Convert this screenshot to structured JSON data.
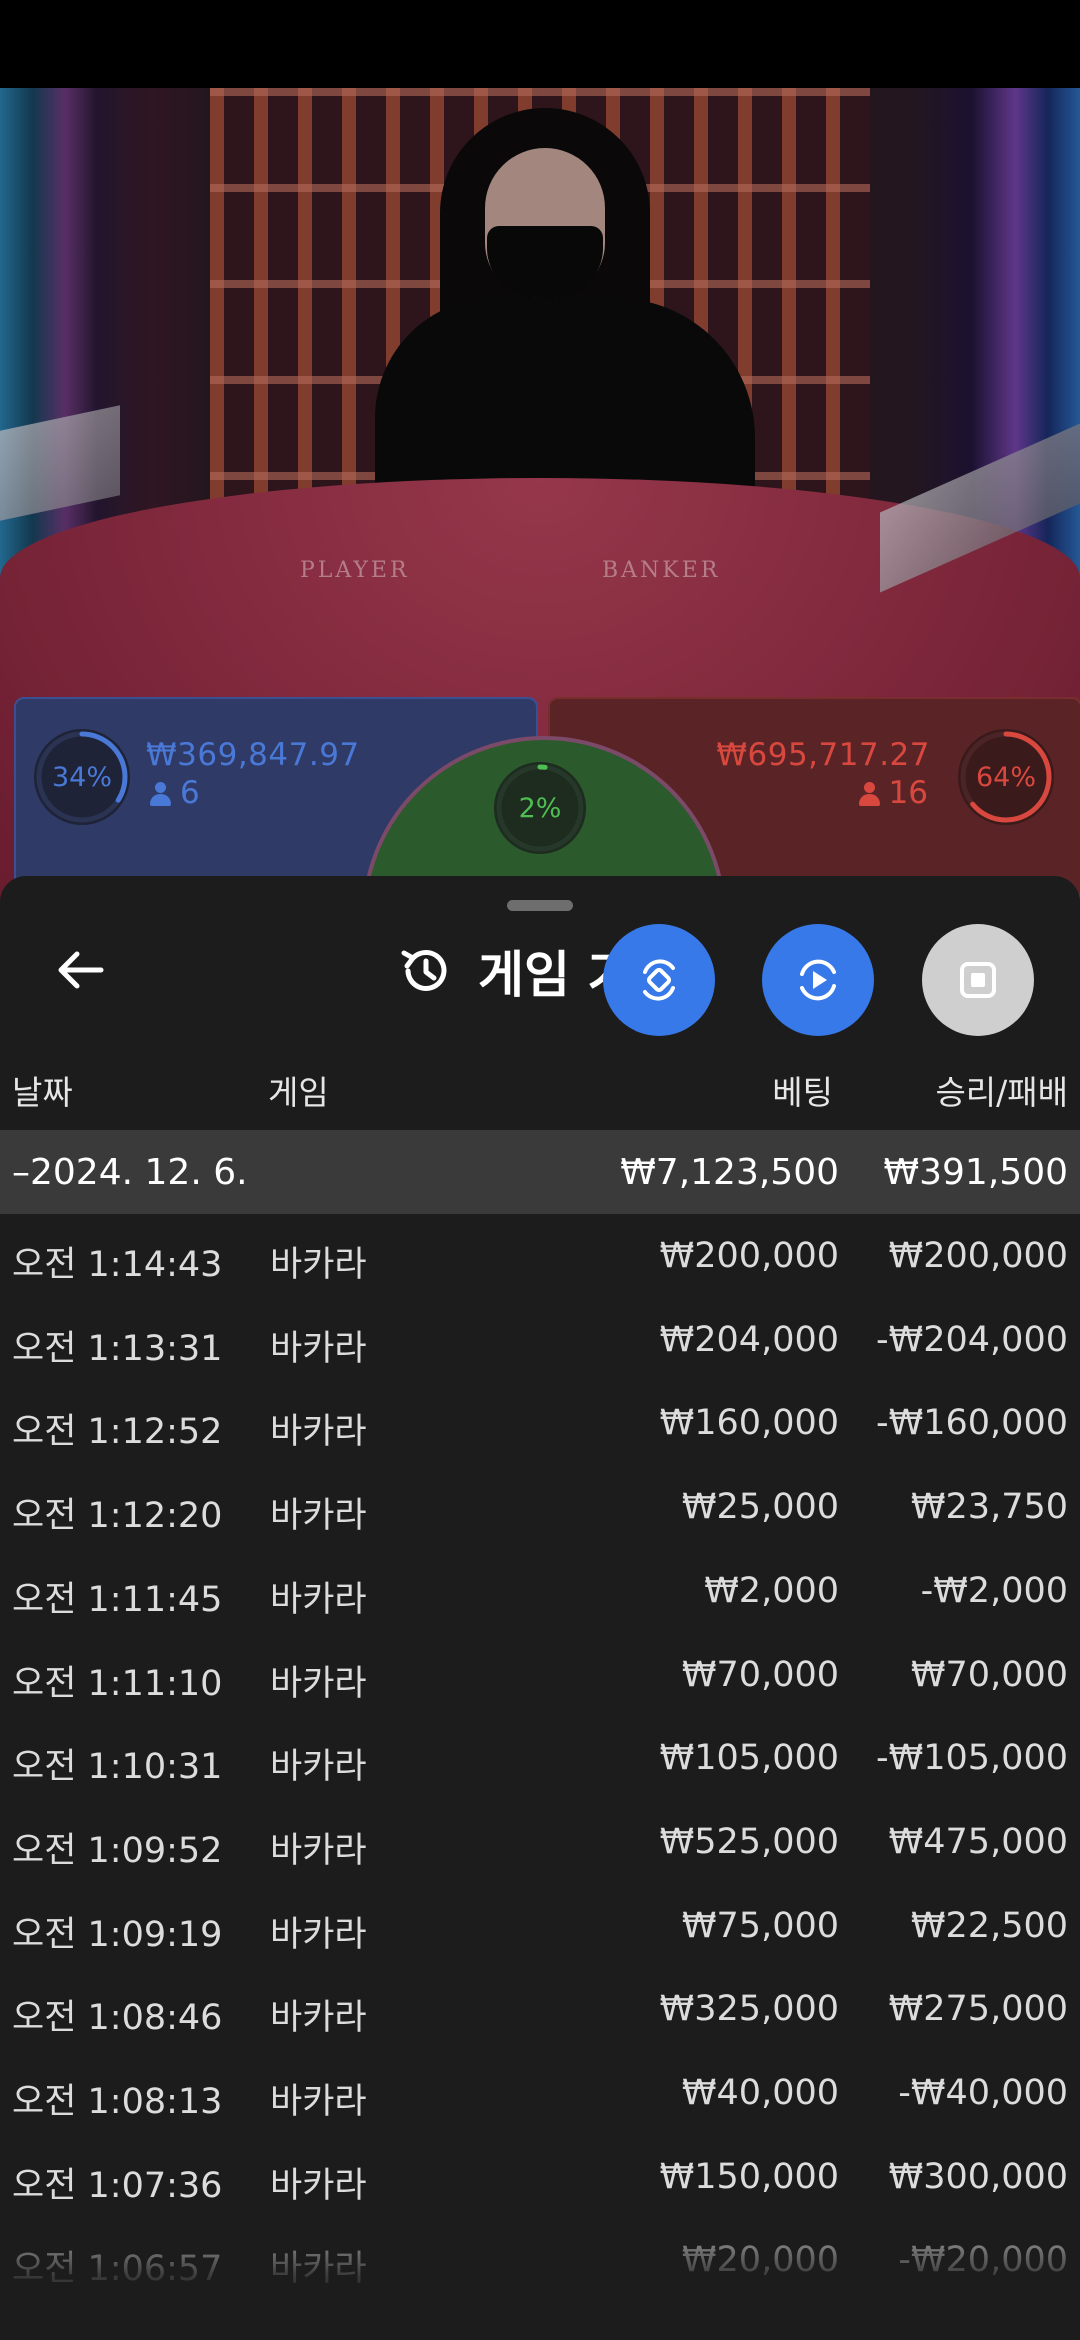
{
  "stream": {
    "table_labels": [
      "PLAYER",
      "BANKER"
    ]
  },
  "bets": {
    "player": {
      "percent_text": "34%",
      "percent": 34,
      "amount": "₩369,847.97",
      "count": "6",
      "color": "#4a78d6"
    },
    "tie": {
      "percent_text": "2%",
      "percent": 2,
      "color": "#4fbe52"
    },
    "banker": {
      "percent_text": "64%",
      "percent": 64,
      "amount": "₩695,717.27",
      "count": "16",
      "color": "#d9483e"
    }
  },
  "sheet": {
    "title": "게임 기록",
    "back_icon": "arrow-left-icon",
    "history_icon": "history-icon",
    "buttons": [
      {
        "name": "sync-icon",
        "color": "#3779e8"
      },
      {
        "name": "replay-icon",
        "color": "#3779e8"
      },
      {
        "name": "stop-icon",
        "color": "#cfcfcf"
      }
    ],
    "columns": {
      "date": "날짜",
      "game": "게임",
      "bet": "베팅",
      "result": "승리/패배"
    },
    "date_group": {
      "label": "–2024. 12. 6.",
      "bet_total": "₩7,123,500",
      "result_total": "₩391,500"
    },
    "rows": [
      {
        "time": "오전 1:14:43",
        "game": "바카라",
        "bet": "₩200,000",
        "result": "₩200,000"
      },
      {
        "time": "오전 1:13:31",
        "game": "바카라",
        "bet": "₩204,000",
        "result": "-₩204,000"
      },
      {
        "time": "오전 1:12:52",
        "game": "바카라",
        "bet": "₩160,000",
        "result": "-₩160,000"
      },
      {
        "time": "오전 1:12:20",
        "game": "바카라",
        "bet": "₩25,000",
        "result": "₩23,750"
      },
      {
        "time": "오전 1:11:45",
        "game": "바카라",
        "bet": "₩2,000",
        "result": "-₩2,000"
      },
      {
        "time": "오전 1:11:10",
        "game": "바카라",
        "bet": "₩70,000",
        "result": "₩70,000"
      },
      {
        "time": "오전 1:10:31",
        "game": "바카라",
        "bet": "₩105,000",
        "result": "-₩105,000"
      },
      {
        "time": "오전 1:09:52",
        "game": "바카라",
        "bet": "₩525,000",
        "result": "₩475,000"
      },
      {
        "time": "오전 1:09:19",
        "game": "바카라",
        "bet": "₩75,000",
        "result": "₩22,500"
      },
      {
        "time": "오전 1:08:46",
        "game": "바카라",
        "bet": "₩325,000",
        "result": "₩275,000"
      },
      {
        "time": "오전 1:08:13",
        "game": "바카라",
        "bet": "₩40,000",
        "result": "-₩40,000"
      },
      {
        "time": "오전 1:07:36",
        "game": "바카라",
        "bet": "₩150,000",
        "result": "₩300,000"
      },
      {
        "time": "오전 1:06:57",
        "game": "바카라",
        "bet": "₩20,000",
        "result": "-₩20,000"
      }
    ]
  }
}
